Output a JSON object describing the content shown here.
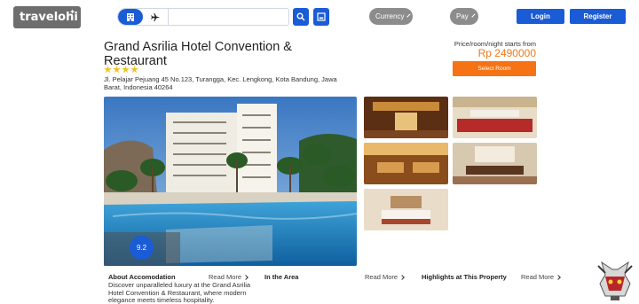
{
  "brand": {
    "logo_text": "travelohi"
  },
  "search": {
    "query": "",
    "placeholder": ""
  },
  "nav": {
    "currency_label": "Currency",
    "pay_label": "Pay",
    "login_label": "Login",
    "register_label": "Register"
  },
  "hotel": {
    "name": "Grand Asrilia Hotel Convention & Restaurant",
    "star_rating": 4,
    "address": "Jl. Pelajar Pejuang 45 No.123, Turangga, Kec. Lengkong, Kota Bandung, Jawa Barat, Indonesia 40264",
    "price_label": "Price/room/night starts from",
    "price": "Rp 2490000",
    "select_room_label": "Select Room",
    "rating_score": "9.2"
  },
  "sections": {
    "about": {
      "title": "About Accomodation",
      "read_more": "Read More",
      "text": "Discover unparalleled luxury at the Grand Asrilia Hotel Convention & Restaurant, where modern elegance meets timeless hospitality."
    },
    "area": {
      "title": "In the Area",
      "read_more": "Read More"
    },
    "highlights": {
      "title": "Highlights at This Property",
      "read_more": "Read More"
    }
  },
  "colors": {
    "primary_blue": "#1a5bd6",
    "accent_orange": "#f57314",
    "price_orange": "#f07a1a",
    "pill_gray": "#8c8c8c",
    "star_yellow": "#f2c21b"
  }
}
